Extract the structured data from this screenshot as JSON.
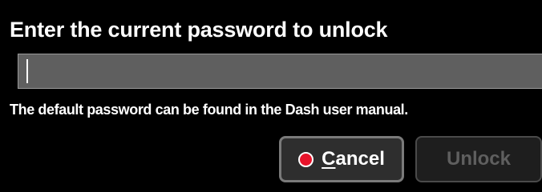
{
  "dialog": {
    "title": "Enter the current password to unlock",
    "password_field": {
      "value": "",
      "placeholder": ""
    },
    "hint": "The default password can be found in the Dash user manual.",
    "buttons": {
      "cancel": {
        "label_first": "C",
        "label_rest": "ancel",
        "icon": "stop-icon",
        "icon_color": "#e8132a",
        "enabled": true
      },
      "unlock": {
        "label": "Unlock",
        "enabled": false
      }
    }
  }
}
